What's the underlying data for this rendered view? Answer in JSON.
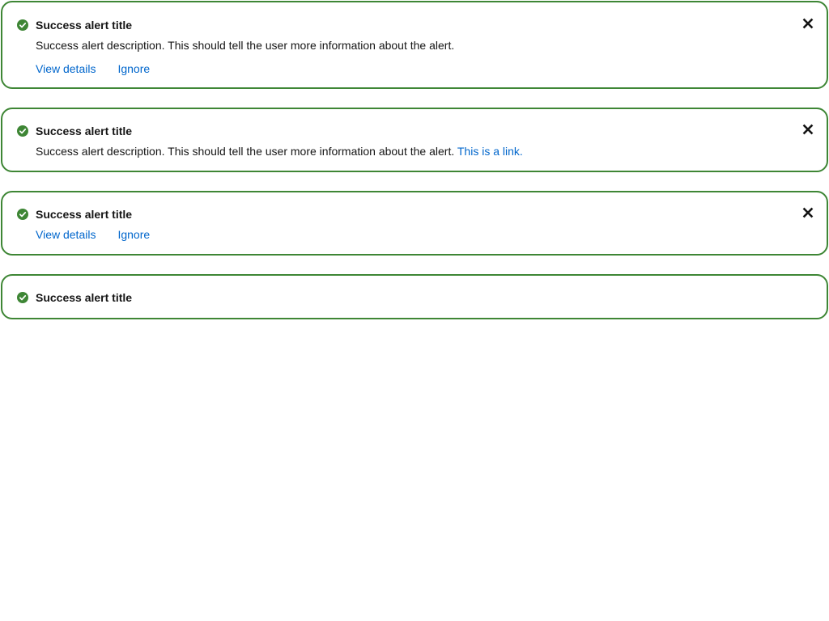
{
  "colors": {
    "success": "#3e8635",
    "link": "#0066cc",
    "text": "#151515"
  },
  "alerts": [
    {
      "icon": "check-circle-icon",
      "title": "Success alert title",
      "description": "Success alert description. This should tell the user more information about the alert.",
      "actions": [
        "View details",
        "Ignore"
      ],
      "dismissible": true
    },
    {
      "icon": "check-circle-icon",
      "title": "Success alert title",
      "description": "Success alert description. This should tell the user more information about the alert.",
      "description_link": "This is a link.",
      "dismissible": true
    },
    {
      "icon": "check-circle-icon",
      "title": "Success alert title",
      "actions": [
        "View details",
        "Ignore"
      ],
      "dismissible": true
    },
    {
      "icon": "check-circle-icon",
      "title": "Success alert title",
      "dismissible": false
    }
  ]
}
